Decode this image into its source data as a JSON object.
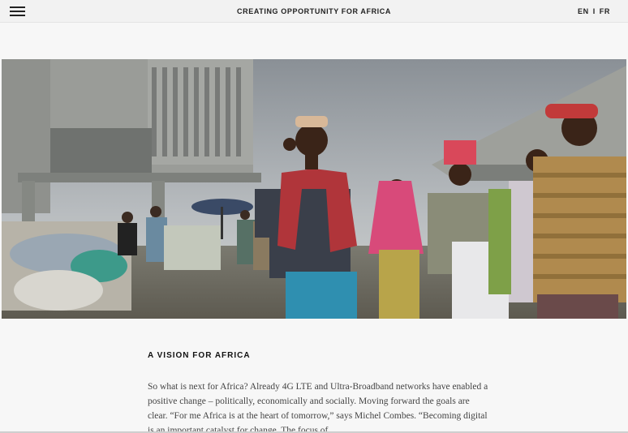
{
  "header": {
    "title": "CREATING OPPORTUNITY FOR AFRICA",
    "lang_en": "EN",
    "lang_sep": "I",
    "lang_fr": "FR"
  },
  "article": {
    "heading": "A VISION FOR AFRICA",
    "paragraph": "So what is next for Africa? Already 4G LTE and Ultra-Broadband networks have enabled a positive change – politically, economically and socially. Moving forward the goals are clear. “For me Africa is at the heart of tomorrow,” says Michel Combes. “Becoming digital is an important catalyst for change. The focus of"
  },
  "colors": {
    "background": "#f7f7f7",
    "text": "#222222",
    "body_text": "#444444"
  },
  "icons": [
    "hamburger-menu-icon"
  ]
}
